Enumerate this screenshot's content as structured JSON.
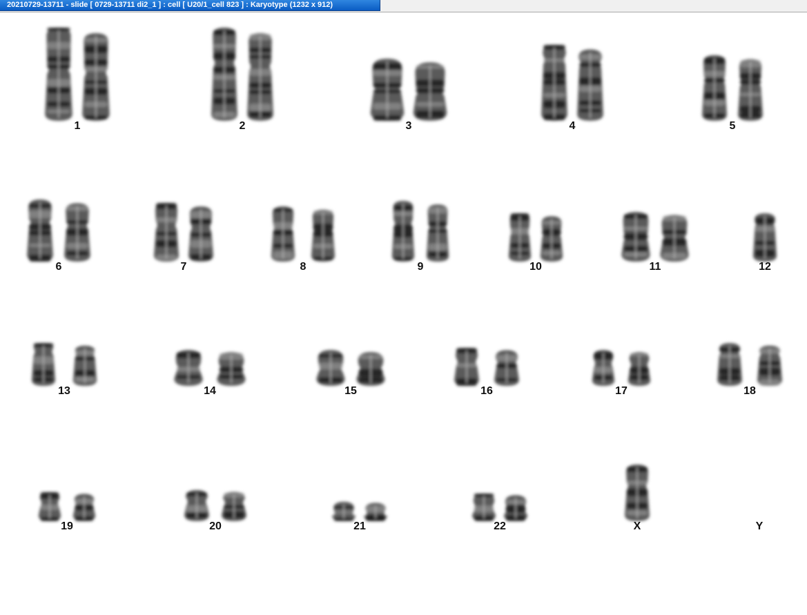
{
  "window": {
    "title": "20210729-13711 - slide [ 0729-13711 di2_1 ] : cell [ U20/1_cell 823 ] : Karyotype  (1232 x 912)"
  },
  "karyotype": {
    "chromosomes": [
      {
        "label": "1",
        "count": 2
      },
      {
        "label": "2",
        "count": 2
      },
      {
        "label": "3",
        "count": 2
      },
      {
        "label": "4",
        "count": 2
      },
      {
        "label": "5",
        "count": 2
      },
      {
        "label": "6",
        "count": 2
      },
      {
        "label": "7",
        "count": 2
      },
      {
        "label": "8",
        "count": 2
      },
      {
        "label": "9",
        "count": 2
      },
      {
        "label": "10",
        "count": 2
      },
      {
        "label": "11",
        "count": 2
      },
      {
        "label": "12",
        "count": 1
      },
      {
        "label": "13",
        "count": 2
      },
      {
        "label": "14",
        "count": 2
      },
      {
        "label": "15",
        "count": 2
      },
      {
        "label": "16",
        "count": 2
      },
      {
        "label": "17",
        "count": 2
      },
      {
        "label": "18",
        "count": 2
      },
      {
        "label": "19",
        "count": 2
      },
      {
        "label": "20",
        "count": 2
      },
      {
        "label": "21",
        "count": 2
      },
      {
        "label": "22",
        "count": 2
      },
      {
        "label": "X",
        "count": 1
      },
      {
        "label": "Y",
        "count": 0
      }
    ]
  }
}
